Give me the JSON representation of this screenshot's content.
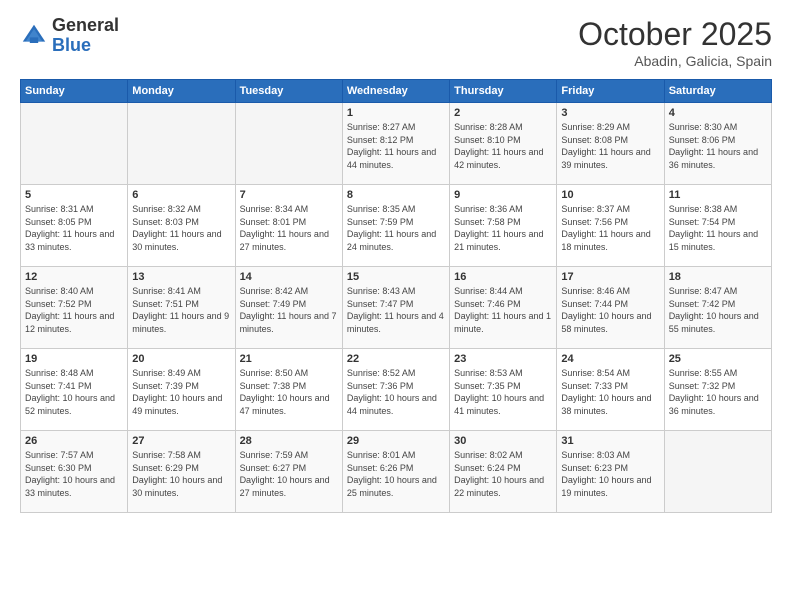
{
  "header": {
    "logo_general": "General",
    "logo_blue": "Blue",
    "month_title": "October 2025",
    "location": "Abadin, Galicia, Spain"
  },
  "days_of_week": [
    "Sunday",
    "Monday",
    "Tuesday",
    "Wednesday",
    "Thursday",
    "Friday",
    "Saturday"
  ],
  "weeks": [
    [
      {
        "day": "",
        "info": ""
      },
      {
        "day": "",
        "info": ""
      },
      {
        "day": "",
        "info": ""
      },
      {
        "day": "1",
        "info": "Sunrise: 8:27 AM\nSunset: 8:12 PM\nDaylight: 11 hours and 44 minutes."
      },
      {
        "day": "2",
        "info": "Sunrise: 8:28 AM\nSunset: 8:10 PM\nDaylight: 11 hours and 42 minutes."
      },
      {
        "day": "3",
        "info": "Sunrise: 8:29 AM\nSunset: 8:08 PM\nDaylight: 11 hours and 39 minutes."
      },
      {
        "day": "4",
        "info": "Sunrise: 8:30 AM\nSunset: 8:06 PM\nDaylight: 11 hours and 36 minutes."
      }
    ],
    [
      {
        "day": "5",
        "info": "Sunrise: 8:31 AM\nSunset: 8:05 PM\nDaylight: 11 hours and 33 minutes."
      },
      {
        "day": "6",
        "info": "Sunrise: 8:32 AM\nSunset: 8:03 PM\nDaylight: 11 hours and 30 minutes."
      },
      {
        "day": "7",
        "info": "Sunrise: 8:34 AM\nSunset: 8:01 PM\nDaylight: 11 hours and 27 minutes."
      },
      {
        "day": "8",
        "info": "Sunrise: 8:35 AM\nSunset: 7:59 PM\nDaylight: 11 hours and 24 minutes."
      },
      {
        "day": "9",
        "info": "Sunrise: 8:36 AM\nSunset: 7:58 PM\nDaylight: 11 hours and 21 minutes."
      },
      {
        "day": "10",
        "info": "Sunrise: 8:37 AM\nSunset: 7:56 PM\nDaylight: 11 hours and 18 minutes."
      },
      {
        "day": "11",
        "info": "Sunrise: 8:38 AM\nSunset: 7:54 PM\nDaylight: 11 hours and 15 minutes."
      }
    ],
    [
      {
        "day": "12",
        "info": "Sunrise: 8:40 AM\nSunset: 7:52 PM\nDaylight: 11 hours and 12 minutes."
      },
      {
        "day": "13",
        "info": "Sunrise: 8:41 AM\nSunset: 7:51 PM\nDaylight: 11 hours and 9 minutes."
      },
      {
        "day": "14",
        "info": "Sunrise: 8:42 AM\nSunset: 7:49 PM\nDaylight: 11 hours and 7 minutes."
      },
      {
        "day": "15",
        "info": "Sunrise: 8:43 AM\nSunset: 7:47 PM\nDaylight: 11 hours and 4 minutes."
      },
      {
        "day": "16",
        "info": "Sunrise: 8:44 AM\nSunset: 7:46 PM\nDaylight: 11 hours and 1 minute."
      },
      {
        "day": "17",
        "info": "Sunrise: 8:46 AM\nSunset: 7:44 PM\nDaylight: 10 hours and 58 minutes."
      },
      {
        "day": "18",
        "info": "Sunrise: 8:47 AM\nSunset: 7:42 PM\nDaylight: 10 hours and 55 minutes."
      }
    ],
    [
      {
        "day": "19",
        "info": "Sunrise: 8:48 AM\nSunset: 7:41 PM\nDaylight: 10 hours and 52 minutes."
      },
      {
        "day": "20",
        "info": "Sunrise: 8:49 AM\nSunset: 7:39 PM\nDaylight: 10 hours and 49 minutes."
      },
      {
        "day": "21",
        "info": "Sunrise: 8:50 AM\nSunset: 7:38 PM\nDaylight: 10 hours and 47 minutes."
      },
      {
        "day": "22",
        "info": "Sunrise: 8:52 AM\nSunset: 7:36 PM\nDaylight: 10 hours and 44 minutes."
      },
      {
        "day": "23",
        "info": "Sunrise: 8:53 AM\nSunset: 7:35 PM\nDaylight: 10 hours and 41 minutes."
      },
      {
        "day": "24",
        "info": "Sunrise: 8:54 AM\nSunset: 7:33 PM\nDaylight: 10 hours and 38 minutes."
      },
      {
        "day": "25",
        "info": "Sunrise: 8:55 AM\nSunset: 7:32 PM\nDaylight: 10 hours and 36 minutes."
      }
    ],
    [
      {
        "day": "26",
        "info": "Sunrise: 7:57 AM\nSunset: 6:30 PM\nDaylight: 10 hours and 33 minutes."
      },
      {
        "day": "27",
        "info": "Sunrise: 7:58 AM\nSunset: 6:29 PM\nDaylight: 10 hours and 30 minutes."
      },
      {
        "day": "28",
        "info": "Sunrise: 7:59 AM\nSunset: 6:27 PM\nDaylight: 10 hours and 27 minutes."
      },
      {
        "day": "29",
        "info": "Sunrise: 8:01 AM\nSunset: 6:26 PM\nDaylight: 10 hours and 25 minutes."
      },
      {
        "day": "30",
        "info": "Sunrise: 8:02 AM\nSunset: 6:24 PM\nDaylight: 10 hours and 22 minutes."
      },
      {
        "day": "31",
        "info": "Sunrise: 8:03 AM\nSunset: 6:23 PM\nDaylight: 10 hours and 19 minutes."
      },
      {
        "day": "",
        "info": ""
      }
    ]
  ]
}
